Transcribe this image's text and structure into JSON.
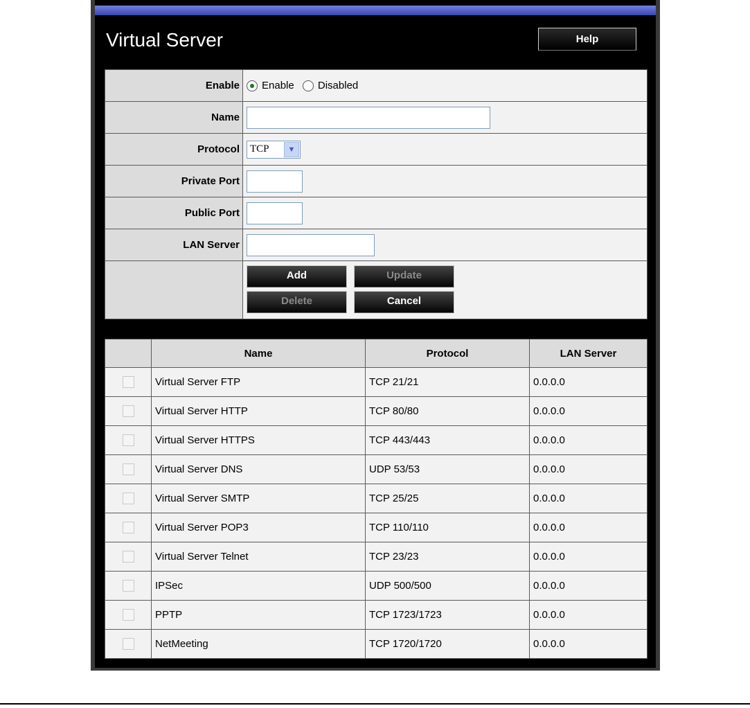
{
  "header": {
    "title": "Virtual Server",
    "help_label": "Help"
  },
  "form": {
    "enable_label": "Enable",
    "enable_option": "Enable",
    "disabled_option": "Disabled",
    "name_label": "Name",
    "name_value": "",
    "protocol_label": "Protocol",
    "protocol_value": "TCP",
    "private_port_label": "Private Port",
    "private_port_value": "",
    "public_port_label": "Public Port",
    "public_port_value": "",
    "lan_server_label": "LAN Server",
    "lan_server_value": "",
    "add_label": "Add",
    "update_label": "Update",
    "delete_label": "Delete",
    "cancel_label": "Cancel"
  },
  "list": {
    "columns": [
      "Name",
      "Protocol",
      "LAN Server"
    ],
    "rows": [
      {
        "name": "Virtual Server FTP",
        "protocol": "TCP 21/21",
        "lan": "0.0.0.0"
      },
      {
        "name": "Virtual Server HTTP",
        "protocol": "TCP 80/80",
        "lan": "0.0.0.0"
      },
      {
        "name": "Virtual Server HTTPS",
        "protocol": "TCP 443/443",
        "lan": "0.0.0.0"
      },
      {
        "name": "Virtual Server DNS",
        "protocol": "UDP 53/53",
        "lan": "0.0.0.0"
      },
      {
        "name": "Virtual Server SMTP",
        "protocol": "TCP 25/25",
        "lan": "0.0.0.0"
      },
      {
        "name": "Virtual Server POP3",
        "protocol": "TCP 110/110",
        "lan": "0.0.0.0"
      },
      {
        "name": "Virtual Server Telnet",
        "protocol": "TCP 23/23",
        "lan": "0.0.0.0"
      },
      {
        "name": "IPSec",
        "protocol": "UDP 500/500",
        "lan": "0.0.0.0"
      },
      {
        "name": "PPTP",
        "protocol": "TCP 1723/1723",
        "lan": "0.0.0.0"
      },
      {
        "name": "NetMeeting",
        "protocol": "TCP 1720/1720",
        "lan": "0.0.0.0"
      }
    ]
  }
}
